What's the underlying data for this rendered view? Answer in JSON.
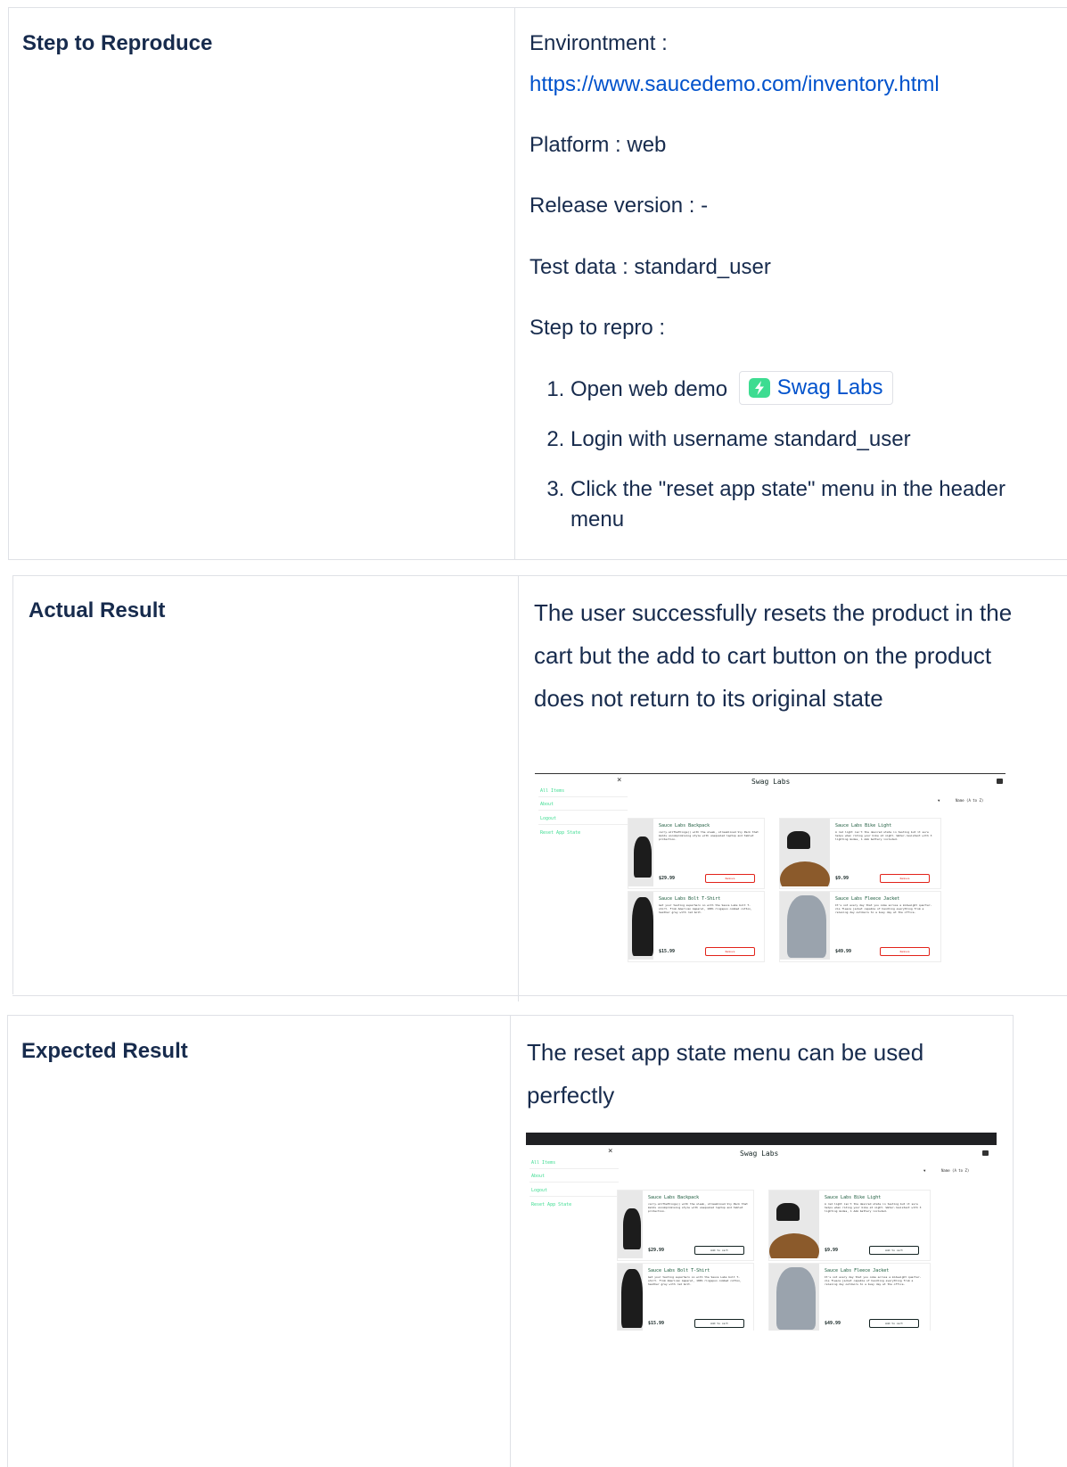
{
  "sections": [
    {
      "label": "Step to Reproduce",
      "environment_label": "Environtment :",
      "environment_url": "https://www.saucedemo.com/inventory.html",
      "platform": "Platform : web",
      "release_version": "Release version : -",
      "test_data": "Test data : standard_user",
      "steps_label": "Step to repro :",
      "steps": [
        "Open web demo",
        "Login with username standard_user",
        "Click the \"reset app state\" menu in the header menu"
      ],
      "chip_label": "Swag Labs",
      "chip_icon": "swag-labs-logo-icon"
    },
    {
      "label": "Actual Result",
      "text": "The user successfully resets the product in the cart but the add to cart button on the product does not return to its original state"
    },
    {
      "label": "Expected Result",
      "text": "The reset app state menu can be used perfectly"
    }
  ],
  "screenshot": {
    "title": "Swag Labs",
    "close_icon": "close-icon",
    "cart_icon": "cart-icon",
    "menu": [
      "All Items",
      "About",
      "Logout",
      "Reset App State"
    ],
    "sort_label": "Name (A to Z)",
    "products": [
      {
        "name": "Sauce Labs Backpack",
        "desc": "carry.allTheThings() with the sleek, streamlined Sly Pack that melds uncompromising style with unequaled laptop and tablet protection.",
        "price": "$29.99"
      },
      {
        "name": "Sauce Labs Bike Light",
        "desc": "A red light isn't the desired state in testing but it sure helps when riding your bike at night. Water-resistant with 3 lighting modes, 1 AAA battery included.",
        "price": "$9.99"
      },
      {
        "name": "Sauce Labs Bolt T-Shirt",
        "desc": "Get your testing superhero on with the Sauce Labs bolt T-shirt. From American Apparel, 100% ringspun combed cotton, heather gray with red bolt.",
        "price": "$15.99"
      },
      {
        "name": "Sauce Labs Fleece Jacket",
        "desc": "It's not every day that you come across a midweight quarter-zip fleece jacket capable of handling everything from a relaxing day outdoors to a busy day at the office.",
        "price": "$49.99"
      }
    ],
    "remove_label": "Remove",
    "add_label": "Add to cart"
  },
  "colors": {
    "border": "#dfe1e6",
    "link": "#0052cc",
    "text": "#172b4d",
    "remove": "#e2231a",
    "menu_green": "#3ddc91"
  }
}
